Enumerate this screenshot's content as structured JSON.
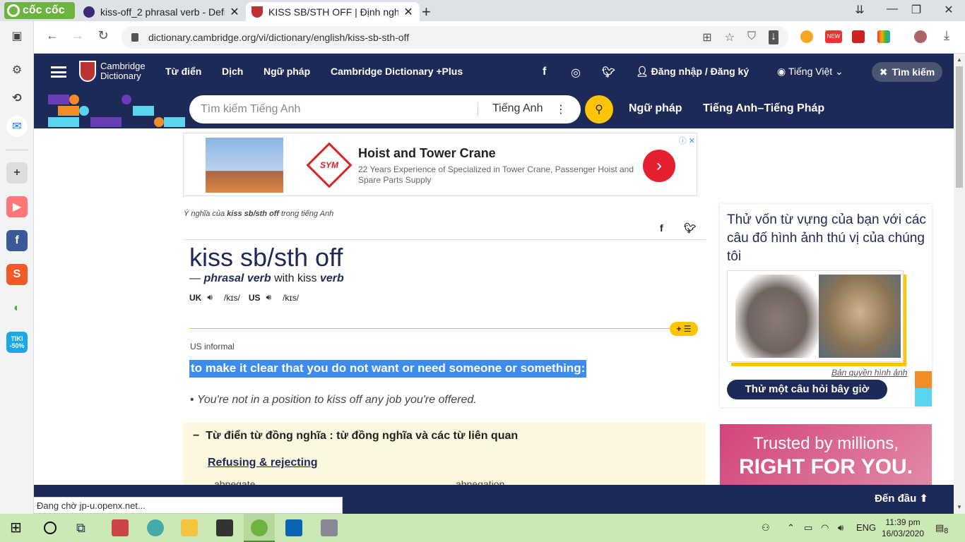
{
  "browser": {
    "brand": "cốc cốc",
    "tabs": [
      {
        "title": "kiss-off_2 phrasal verb - Defin",
        "active": false
      },
      {
        "title": "KISS SB/STH OFF | Định nghĩa",
        "active": true
      }
    ],
    "url": "dictionary.cambridge.org/vi/dictionary/english/kiss-sb-sth-off",
    "ext_badge": "NEW"
  },
  "sidebar": {
    "badge": "TIKI -50%"
  },
  "site": {
    "logo_line1": "Cambridge",
    "logo_line2": "Dictionary",
    "nav": [
      "Từ điển",
      "Dịch",
      "Ngữ pháp",
      "Cambridge Dictionary +Plus"
    ],
    "login": "Đăng nhập / Đăng ký",
    "language": "Tiếng Việt",
    "search_btn": "Tìm kiếm",
    "search_placeholder": "Tìm kiếm Tiếng Anh",
    "search_lang": "Tiếng Anh",
    "links": [
      "Ngữ pháp",
      "Tiếng Anh–Tiếng Pháp"
    ],
    "colors": {
      "navy": "#1d2a57",
      "yellow": "#fec400"
    }
  },
  "ad": {
    "title": "Hoist and Tower Crane",
    "desc": "22 Years Experience of Specialized in Tower Crane, Passenger Hoist and Spare Parts Supply",
    "logo": "SYM"
  },
  "entry": {
    "crumb_prefix": "Ý nghĩa của",
    "crumb_word": "kiss sb/sth off",
    "crumb_suffix": "trong tiếng Anh",
    "headword": "kiss sb/sth off",
    "pos_dash": "—",
    "pos": "phrasal verb",
    "pos_with": "with kiss",
    "pos_verb": "verb",
    "uk": "UK",
    "us": "US",
    "ipa_uk": "/kɪs/",
    "ipa_us": "/kɪs/",
    "usage": "US informal",
    "definition": "to make it clear that you do not want or need someone or something:",
    "example": "You're not in a position to kiss off any job you're offered.",
    "thesaurus_title": "Từ điển từ đồng nghĩa : từ đồng nghĩa và các từ liên quan",
    "thesaurus_category": "Refusing & rejecting",
    "thesaurus_words": [
      "abnegate",
      "abnegation"
    ],
    "toggle_btn": "+ ☰"
  },
  "quiz": {
    "title": "Thử vốn từ vựng của bạn với các câu đố hình ảnh thú vị của chúng tôi",
    "credit": "Bản quyền hình ảnh",
    "button": "Thử một câu hỏi bây giờ"
  },
  "ad2": {
    "line1": "Trusted by millions,",
    "line2": "RIGHT FOR YOU."
  },
  "bottom": {
    "back_to_top": "Đến đầu",
    "status": "Đang chờ jp-u.openx.net..."
  },
  "taskbar": {
    "lang": "ENG",
    "time": "11:39 pm",
    "date": "16/03/2020",
    "notif": "8"
  }
}
